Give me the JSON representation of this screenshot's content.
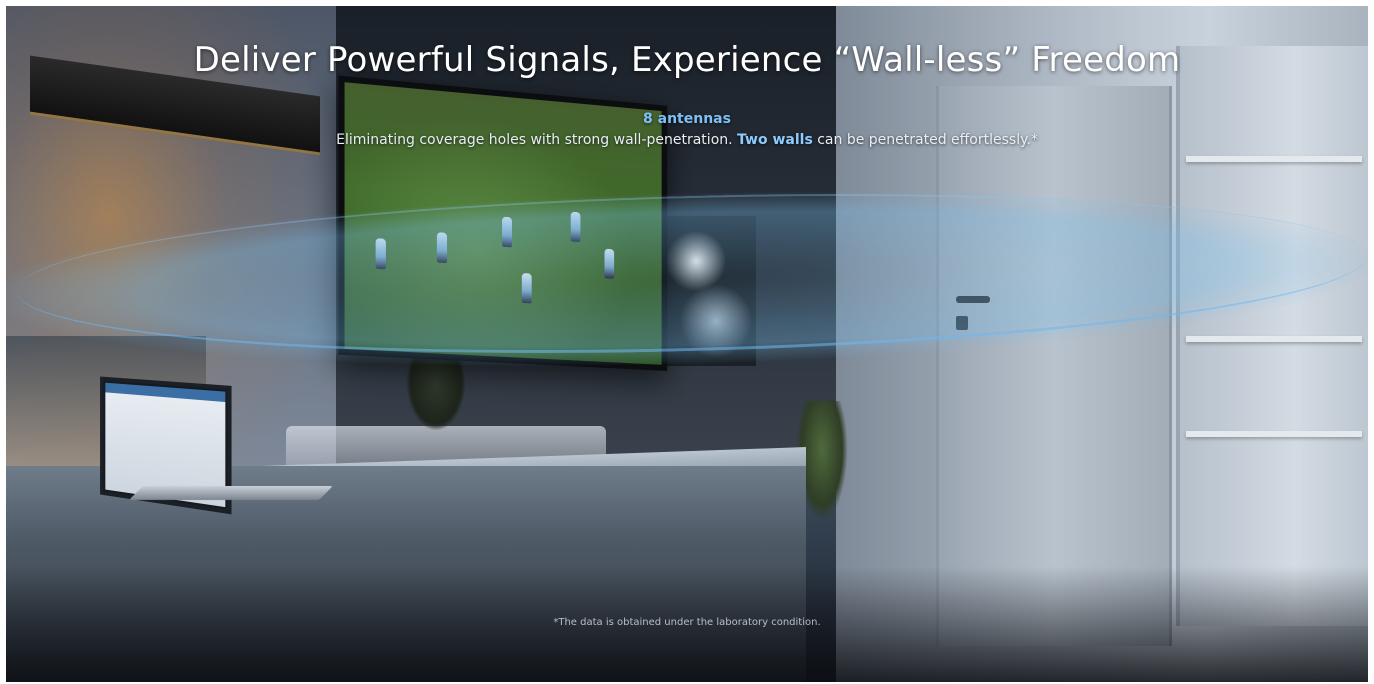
{
  "hero": {
    "headline": "Deliver Powerful Signals, Experience “Wall-less” Freedom",
    "subhead": "8 antennas",
    "description": {
      "before": "Eliminating coverage holes with strong wall-penetration. ",
      "highlight": "Two walls",
      "after": " can be penetrated effortlessly.*"
    },
    "footnote": "*The data is obtained under the laboratory condition."
  },
  "colors": {
    "accent": "#7ec0f5",
    "text": "#ffffff"
  }
}
